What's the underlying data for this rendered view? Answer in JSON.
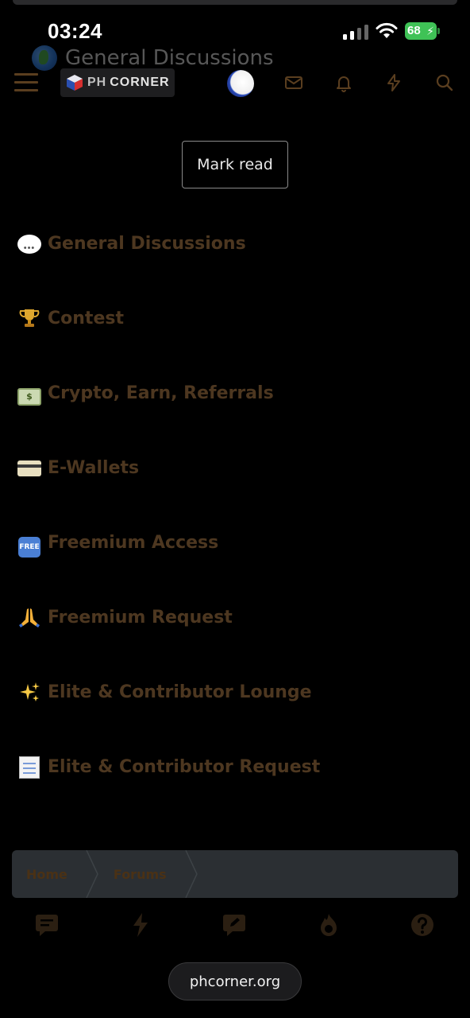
{
  "status_bar": {
    "time": "03:24",
    "battery_level": "68"
  },
  "page_header": {
    "title": "General Discussions"
  },
  "nav": {
    "logo_ph": "PH",
    "logo_corner": "CORNER"
  },
  "mark_read_label": "Mark read",
  "forums": [
    {
      "title": "General Discussions",
      "icon": "speech-bubble-icon"
    },
    {
      "title": "Contest",
      "icon": "trophy-icon"
    },
    {
      "title": "Crypto, Earn, Referrals",
      "icon": "money-icon"
    },
    {
      "title": "E-Wallets",
      "icon": "credit-card-icon"
    },
    {
      "title": "Freemium Access",
      "icon": "free-badge-icon"
    },
    {
      "title": "Freemium Request",
      "icon": "praying-hands-icon"
    },
    {
      "title": "Elite & Contributor Lounge",
      "icon": "sparkles-icon"
    },
    {
      "title": "Elite & Contributor Request",
      "icon": "memo-icon"
    }
  ],
  "breadcrumb": [
    "Home",
    "Forums"
  ],
  "browser": {
    "url": "phcorner.org"
  },
  "colors": {
    "forum_title": "#4d3720",
    "accent_dim": "#5a3e1f",
    "breadcrumb_bg": "#2b2f33",
    "battery": "#3fc256"
  }
}
